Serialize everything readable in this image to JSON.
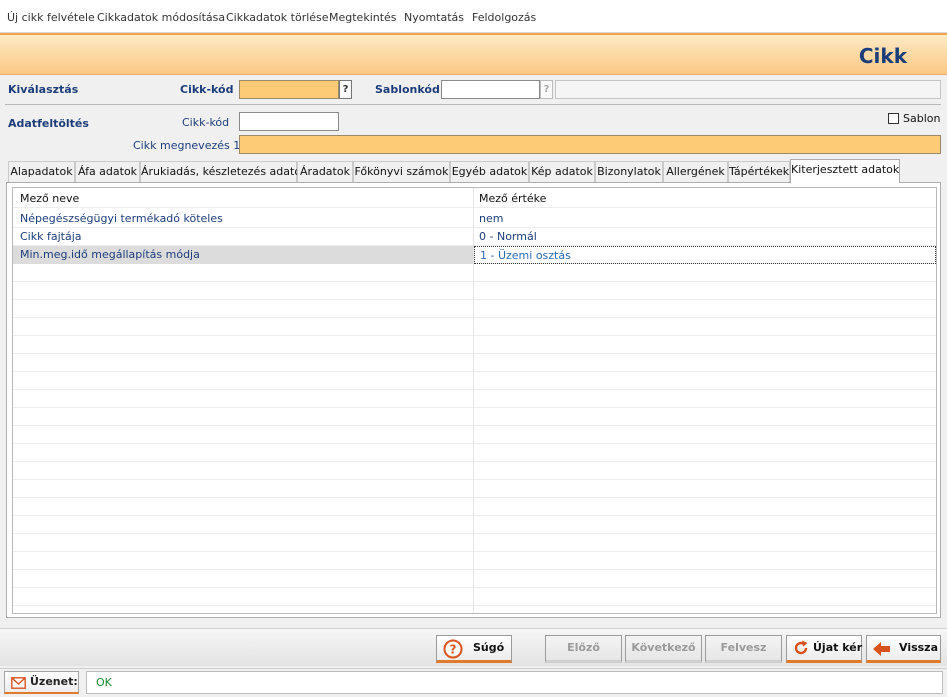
{
  "menu": [
    "Új cikk felvétele",
    "Cikkadatok módosítása",
    "Cikkadatok törlése",
    "Megtekintés",
    "Nyomtatás",
    "Feldolgozás"
  ],
  "header": {
    "title": "Cikk"
  },
  "selection": {
    "section_label": "Kiválasztás",
    "code_label": "Cikk-kód",
    "code_value": "",
    "lookup_label": "?",
    "template_label": "Sablonkód",
    "template_value": "",
    "template_lookup_label": "?"
  },
  "upload": {
    "section_label": "Adatfeltöltés",
    "code_label": "Cikk-kód",
    "code_value": "",
    "template_checkbox_label": "Sablon",
    "template_checked": false,
    "name_label": "Cikk megnevezés 1",
    "name_value": ""
  },
  "tabs": [
    "Alapadatok",
    "Áfa adatok",
    "Árukiadás, készletezés adatok",
    "Áradatok",
    "Főkönyvi számok",
    "Egyéb adatok",
    "Kép adatok",
    "Bizonylatok",
    "Allergének",
    "Tápértékek",
    "Kiterjesztett adatok"
  ],
  "active_tab": "Kiterjesztett adatok",
  "grid": {
    "columns": [
      "Mező neve",
      "Mező értéke"
    ],
    "rows": [
      {
        "name": "Népegészségügyi termékadó köteles",
        "value": "nem"
      },
      {
        "name": "Cikk fajtája",
        "value": "0 - Normál"
      },
      {
        "name": "Min.meg.idő megállapítás módja",
        "value": "1 - Üzemi osztás"
      }
    ],
    "selected_row": 2
  },
  "buttons": {
    "help": "Súgó",
    "prev": "Előző",
    "next": "Következő",
    "save": "Felvesz",
    "new": "Újat kér",
    "back": "Vissza"
  },
  "status": {
    "message_label": "Üzenet:",
    "message": "OK"
  },
  "colors": {
    "accent": "#e07a2c",
    "header_text": "#1d3d7a",
    "required_field": "#fdca75",
    "ok_text": "#1c8a2e"
  }
}
